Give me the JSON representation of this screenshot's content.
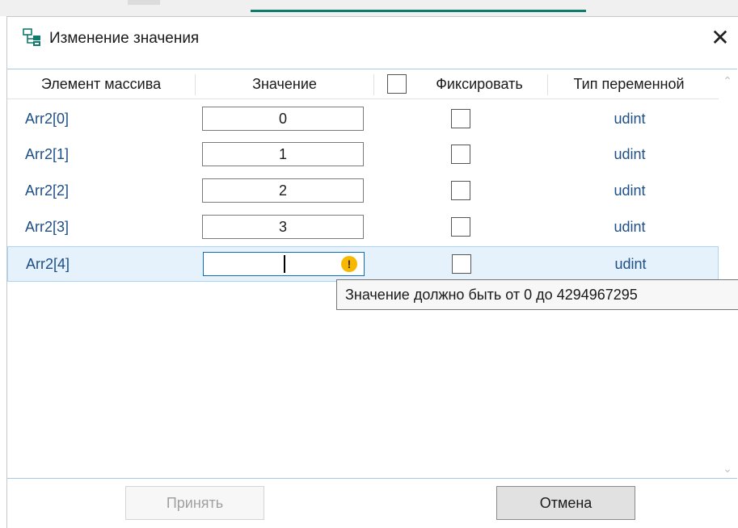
{
  "window": {
    "title": "Изменение значения",
    "close_glyph": "✕",
    "icon": "array-edit-icon"
  },
  "table": {
    "headers": {
      "element": "Элемент массива",
      "value": "Значение",
      "fix": "Фиксировать",
      "type": "Тип переменной"
    },
    "rows": [
      {
        "name": "Arr2[0]",
        "value": "0",
        "fixed": false,
        "type": "udint"
      },
      {
        "name": "Arr2[1]",
        "value": "1",
        "fixed": false,
        "type": "udint"
      },
      {
        "name": "Arr2[2]",
        "value": "2",
        "fixed": false,
        "type": "udint"
      },
      {
        "name": "Arr2[3]",
        "value": "3",
        "fixed": false,
        "type": "udint"
      },
      {
        "name": "Arr2[4]",
        "value": "",
        "fixed": false,
        "type": "udint"
      }
    ],
    "selected_row": 4
  },
  "tooltip": {
    "text": "Значение должно быть от 0 до 4294967295"
  },
  "buttons": {
    "accept": "Принять",
    "cancel": "Отмена"
  },
  "colors": {
    "accent": "#0f7b6c",
    "link_text": "#1e4f86",
    "warning": "#f9b800",
    "selection": "#e5f1fb"
  }
}
